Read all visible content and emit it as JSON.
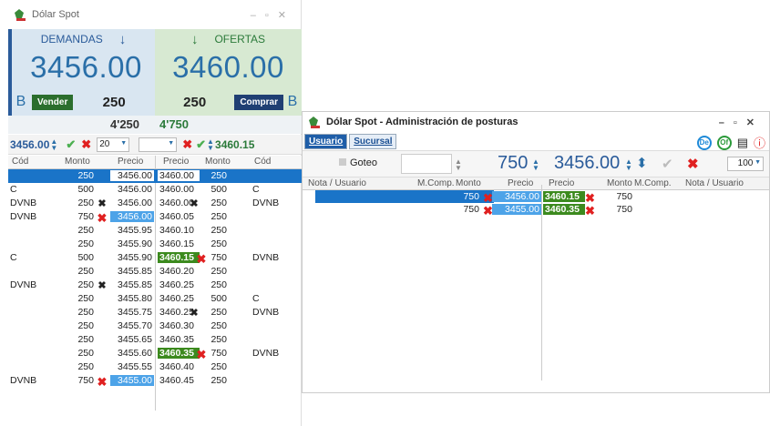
{
  "w1": {
    "title": "Dólar Spot",
    "demandas": "DEMANDAS",
    "ofertas": "OFERTAS",
    "bid": "3456.00",
    "ask": "3460.00",
    "b_left": "B",
    "b_right": "B",
    "vender": "Vender",
    "comprar": "Comprar",
    "qty_bid": "250",
    "qty_ask": "250",
    "tot_bid": "4'250",
    "tot_ask": "4'750",
    "f_price_bid": "3456.00",
    "f_qty": "20",
    "f_price_ask": "3460.15",
    "headers": [
      "Cód",
      "Monto",
      "Precio",
      "Precio",
      "Monto",
      "Cód"
    ],
    "rows": [
      {
        "cb": "",
        "mb": "250",
        "pb": "3456.00",
        "po": "3460.00",
        "mo": "250",
        "co": "",
        "sel": true
      },
      {
        "cb": "C",
        "mb": "500",
        "pb": "3456.00",
        "po": "3460.00",
        "mo": "500",
        "co": "C"
      },
      {
        "cb": "DVNB",
        "mb": "250",
        "pb": "3456.00",
        "po": "3460.00",
        "mo": "250",
        "co": "DVNB",
        "xb": "✖",
        "xo": "✖"
      },
      {
        "cb": "DVNB",
        "mb": "750",
        "pb": "3456.00",
        "po": "3460.05",
        "mo": "250",
        "co": "",
        "xbr": "✖",
        "hb": true
      },
      {
        "cb": "",
        "mb": "250",
        "pb": "3455.95",
        "po": "3460.10",
        "mo": "250",
        "co": ""
      },
      {
        "cb": "",
        "mb": "250",
        "pb": "3455.90",
        "po": "3460.15",
        "mo": "250",
        "co": ""
      },
      {
        "cb": "C",
        "mb": "500",
        "pb": "3455.90",
        "po": "3460.15",
        "mo": "750",
        "co": "DVNB",
        "xor": "✖",
        "ho": true
      },
      {
        "cb": "",
        "mb": "250",
        "pb": "3455.85",
        "po": "3460.20",
        "mo": "250",
        "co": ""
      },
      {
        "cb": "DVNB",
        "mb": "250",
        "pb": "3455.85",
        "po": "3460.25",
        "mo": "250",
        "co": "",
        "xb": "✖"
      },
      {
        "cb": "",
        "mb": "250",
        "pb": "3455.80",
        "po": "3460.25",
        "mo": "500",
        "co": "C"
      },
      {
        "cb": "",
        "mb": "250",
        "pb": "3455.75",
        "po": "3460.25",
        "mo": "250",
        "co": "DVNB",
        "xo": "✖"
      },
      {
        "cb": "",
        "mb": "250",
        "pb": "3455.70",
        "po": "3460.30",
        "mo": "250",
        "co": ""
      },
      {
        "cb": "",
        "mb": "250",
        "pb": "3455.65",
        "po": "3460.35",
        "mo": "250",
        "co": ""
      },
      {
        "cb": "",
        "mb": "250",
        "pb": "3455.60",
        "po": "3460.35",
        "mo": "750",
        "co": "DVNB",
        "xor": "✖",
        "ho": true
      },
      {
        "cb": "",
        "mb": "250",
        "pb": "3455.55",
        "po": "3460.40",
        "mo": "250",
        "co": ""
      },
      {
        "cb": "DVNB",
        "mb": "750",
        "pb": "3455.00",
        "po": "3460.45",
        "mo": "250",
        "co": "",
        "xbr": "✖",
        "hb": true
      }
    ]
  },
  "w2": {
    "title": "Dólar Spot - Administración de posturas",
    "tab1": "Usuario",
    "tab2": "Sucursal",
    "goteo": "Goteo",
    "qty": "750",
    "price": "3456.00",
    "sel": "100",
    "icons": [
      "De",
      "Of"
    ],
    "headers": [
      "Nota / Usuario",
      "M.Comp.",
      "Monto",
      "Precio",
      "Precio",
      "Monto",
      "M.Comp.",
      "Nota / Usuario"
    ],
    "rows": [
      {
        "mb": "750",
        "pb": "3456.00",
        "po": "3460.15",
        "mo": "750"
      },
      {
        "mb": "750",
        "pb": "3455.00",
        "po": "3460.35",
        "mo": "750"
      }
    ]
  }
}
